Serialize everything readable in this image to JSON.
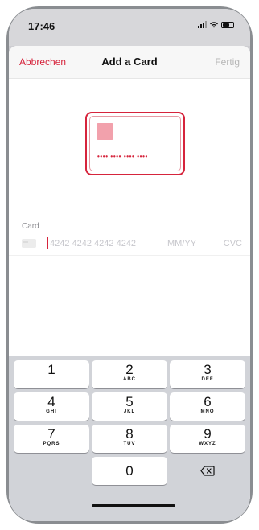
{
  "status": {
    "time": "17:46"
  },
  "nav": {
    "cancel": "Abbrechen",
    "title": "Add a Card",
    "done": "Fertig"
  },
  "card_preview": {
    "dots": "•••• •••• •••• ••••"
  },
  "form": {
    "label": "Card",
    "number_placeholder": "4242 4242 4242 4242",
    "expiry_placeholder": "MM/YY",
    "cvc_placeholder": "CVC"
  },
  "keypad": {
    "k1": {
      "digit": "1",
      "letters": ""
    },
    "k2": {
      "digit": "2",
      "letters": "ABC"
    },
    "k3": {
      "digit": "3",
      "letters": "DEF"
    },
    "k4": {
      "digit": "4",
      "letters": "GHI"
    },
    "k5": {
      "digit": "5",
      "letters": "JKL"
    },
    "k6": {
      "digit": "6",
      "letters": "MNO"
    },
    "k7": {
      "digit": "7",
      "letters": "PQRS"
    },
    "k8": {
      "digit": "8",
      "letters": "TUV"
    },
    "k9": {
      "digit": "9",
      "letters": "WXYZ"
    },
    "k0": {
      "digit": "0"
    },
    "delete_icon": "backspace-icon"
  },
  "colors": {
    "accent": "#d6243c",
    "placeholder": "#c7c7cc",
    "keyboard_bg": "#d1d3d8"
  }
}
